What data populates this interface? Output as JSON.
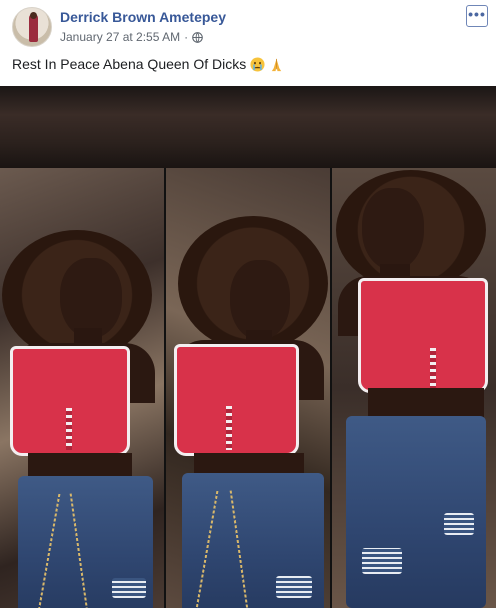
{
  "post": {
    "author": "Derrick Brown Ametepey",
    "date": "January 27 at 2:55 AM",
    "separator": "·",
    "privacy_icon": "globe-icon",
    "more_icon": "more-options-icon",
    "more_label": "•••",
    "caption": "Rest In Peace Abena Queen Of Dicks",
    "caption_emojis": [
      "crying-face-emoji",
      "folded-hands-emoji"
    ]
  },
  "colors": {
    "author_link": "#385898",
    "meta_text": "#606770",
    "body_text": "#1c1e21"
  }
}
